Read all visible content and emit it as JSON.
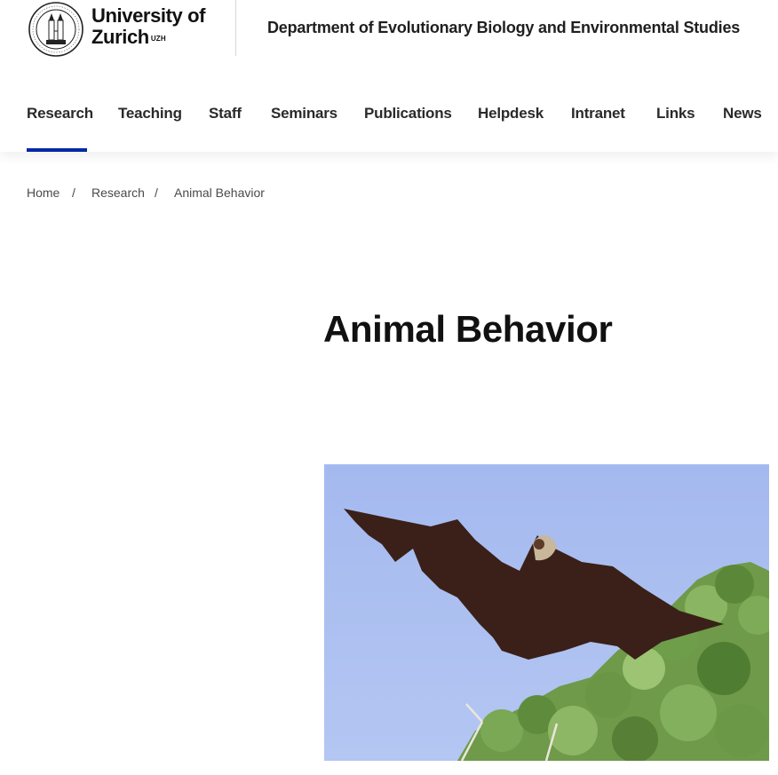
{
  "header": {
    "logo_line1": "University of",
    "logo_line2": "Zurich",
    "logo_sup": "UZH",
    "department": "Department of Evolutionary Biology and Environmental Studies"
  },
  "nav": {
    "items": [
      {
        "label": "Research",
        "active": true
      },
      {
        "label": "Teaching"
      },
      {
        "label": "Staff"
      },
      {
        "label": "Seminars"
      },
      {
        "label": "Publications"
      },
      {
        "label": "Helpdesk"
      },
      {
        "label": "Intranet"
      },
      {
        "label": "Links"
      },
      {
        "label": "News"
      }
    ]
  },
  "breadcrumb": {
    "home": "Home",
    "research": "Research",
    "current": "Animal Behavior",
    "separator": "/"
  },
  "main": {
    "title": "Animal Behavior"
  },
  "colors": {
    "accent": "#0028a5",
    "sky": "#a9bdf0"
  }
}
